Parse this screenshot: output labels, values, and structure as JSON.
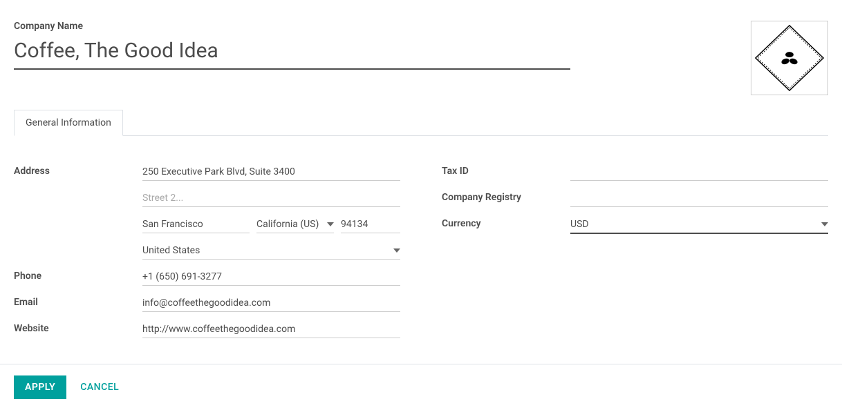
{
  "header": {
    "companyNameLabel": "Company Name",
    "companyName": "Coffee, The Good Idea"
  },
  "tabs": {
    "generalInformation": "General Information"
  },
  "fields": {
    "left": {
      "addressLabel": "Address",
      "street": "250 Executive Park Blvd, Suite 3400",
      "street2Placeholder": "Street 2...",
      "street2": "",
      "city": "San Francisco",
      "state": "California (US)",
      "zip": "94134",
      "country": "United States",
      "phoneLabel": "Phone",
      "phone": "+1 (650) 691-3277",
      "emailLabel": "Email",
      "email": "info@coffeethegoodidea.com",
      "websiteLabel": "Website",
      "website": "http://www.coffeethegoodidea.com"
    },
    "right": {
      "taxIdLabel": "Tax ID",
      "taxId": "",
      "companyRegistryLabel": "Company Registry",
      "companyRegistry": "",
      "currencyLabel": "Currency",
      "currency": "USD"
    }
  },
  "footer": {
    "apply": "Apply",
    "cancel": "Cancel"
  }
}
